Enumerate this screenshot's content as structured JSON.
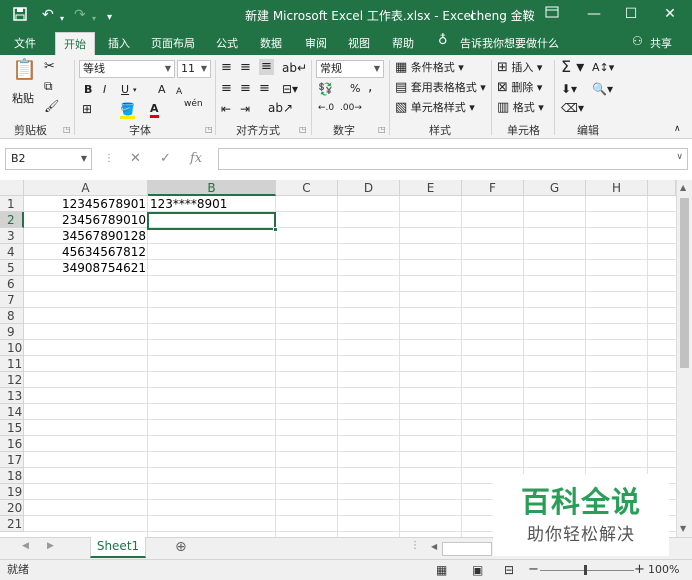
{
  "titlebar": {
    "save_icon": "save-icon",
    "undo_icon": "undo-icon",
    "redo_icon": "redo-icon",
    "customize_icon": "customize-icon",
    "title": "新建 Microsoft Excel 工作表.xlsx - Excel",
    "user": "cheng 金鞍"
  },
  "tabs": [
    "文件",
    "开始",
    "插入",
    "页面布局",
    "公式",
    "数据",
    "审阅",
    "视图",
    "帮助"
  ],
  "active_tab": "开始",
  "tell_me": "告诉我你想要做什么",
  "share": "共享",
  "ribbon": {
    "clipboard": {
      "paste": "粘贴",
      "label": "剪贴板"
    },
    "font": {
      "name": "等线",
      "size": "11",
      "bold": "B",
      "italic": "I",
      "underline": "U",
      "grow": "A",
      "shrink": "A",
      "color": "A",
      "wen": "wén",
      "label": "字体"
    },
    "alignment": {
      "label": "对齐方式"
    },
    "number": {
      "format": "常规",
      "percent": "%",
      "comma": ",",
      "label": "数字"
    },
    "styles": {
      "conditional": "条件格式",
      "table": "套用表格格式",
      "cell": "单元格样式",
      "label": "样式"
    },
    "cells": {
      "insert": "插入",
      "delete": "删除",
      "format": "格式",
      "label": "单元格"
    },
    "editing": {
      "label": "编辑"
    }
  },
  "namebox": "B2",
  "formula_value": "",
  "columns": [
    "A",
    "B",
    "C",
    "D",
    "E",
    "F",
    "G",
    "H"
  ],
  "rows": [
    "1",
    "2",
    "3",
    "4",
    "5",
    "6",
    "7",
    "8",
    "9",
    "10",
    "11",
    "12",
    "13",
    "14",
    "15",
    "16",
    "17",
    "18",
    "19",
    "20",
    "21"
  ],
  "cells": {
    "A1": "12345678901",
    "B1": "123****8901",
    "A2": "23456789010",
    "A3": "34567890128",
    "A4": "45634567812",
    "A5": "34908754621"
  },
  "selected_cell": "B2",
  "sheet_tab": "Sheet1",
  "status": "就绪",
  "zoom": "100%",
  "watermark": {
    "line1": "百科全说",
    "line2": "助你轻松解决"
  },
  "colors": {
    "accent": "#217346",
    "watermark": "#2a9e59"
  }
}
